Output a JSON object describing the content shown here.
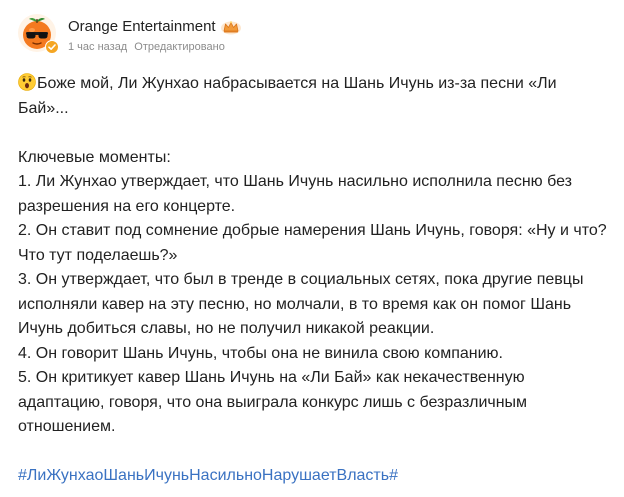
{
  "post": {
    "author": "Orange Entertainment",
    "time": "1 час назад",
    "edited": "Отредактировано",
    "lead": "Боже мой, Ли Жунхао набрасывается на Шань Ичунь из-за песни «Ли Бай»...",
    "section_title": "Ключевые моменты:",
    "points": [
      "1. Ли Жунхао утверждает, что Шань Ичунь насильно исполнила песню без разрешения на его концерте.",
      "2. Он ставит под сомнение добрые намерения Шань Ичунь, говоря: «Ну и что? Что тут поделаешь?»",
      "3. Он утверждает, что был в тренде в социальных сетях, пока другие певцы исполняли кавер на эту песню, но молчали, в то время как он помог Шань Ичунь добиться славы, но не получил никакой реакции.",
      "4. Он говорит Шань Ичунь, чтобы она не винила свою компанию.",
      "5. Он критикует кавер Шань Ичунь на «Ли Бай» как некачественную адаптацию, говоря, что она выиграла конкурс лишь с безразличным отношением."
    ],
    "hashtag": "#ЛиЖунхаоШаньИчуньНасильноНарушаетВласть#"
  },
  "icons": {
    "avatar": "orange-with-sunglasses-avatar",
    "verified": "verified-badge-icon",
    "crown": "crown-badge-icon",
    "lead_emoji": "astonished-face-emoji"
  },
  "colors": {
    "hashtag": "#3a72c2",
    "meta_text": "#8c8c8c",
    "body_text": "#222222",
    "orange": "#f47a20",
    "verified": "#f5a623"
  }
}
